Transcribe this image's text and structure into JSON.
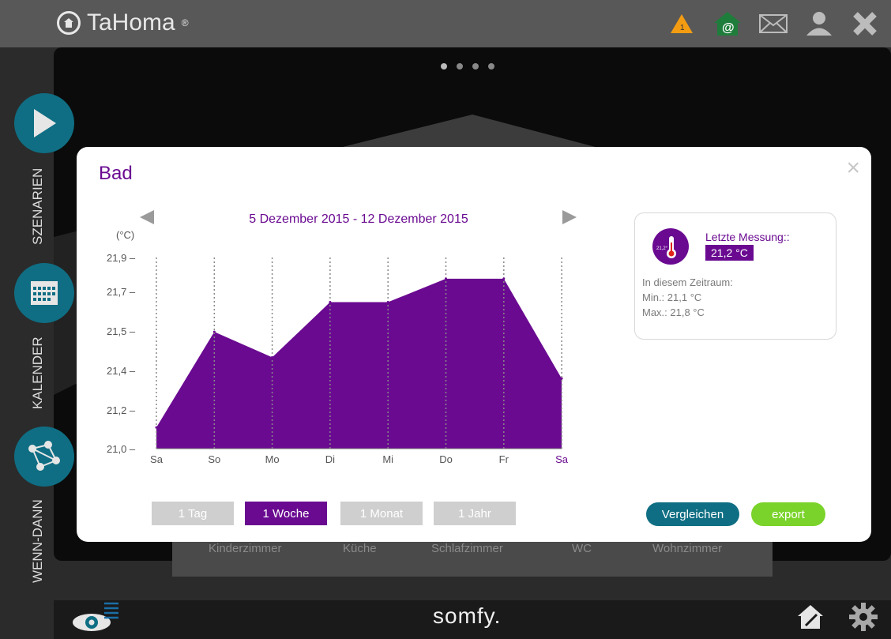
{
  "app": {
    "name": "TaHoma",
    "reg": "®",
    "footer_brand": "somfy."
  },
  "colors": {
    "accent": "#6a0a91",
    "teal": "#0f6e83",
    "green": "#7ad32a"
  },
  "top_icons": [
    "warning-icon",
    "home-web-icon",
    "mail-icon",
    "user-icon",
    "close-icon"
  ],
  "rail": {
    "scenarios": "SZENARIEN",
    "calendar": "KALENDER",
    "if_then": "WENN-DANN"
  },
  "rooms": [
    "Kinderzimmer",
    "Küche",
    "Schlafzimmer",
    "WC",
    "Wohnzimmer"
  ],
  "modal": {
    "title": "Bad",
    "close": "×",
    "date_range": "5 Dezember 2015 - 12 Dezember 2015",
    "range_buttons": [
      "1 Tag",
      "1 Woche",
      "1 Monat",
      "1 Jahr"
    ],
    "active_range": "1 Woche",
    "compare_label": "Vergleichen",
    "export_label": "export"
  },
  "info": {
    "last_label": "Letzte Messung::",
    "last_value": "21,2 °C",
    "therm_text": "21,2°",
    "period_label": "In diesem Zeitraum:",
    "min": "Min.: 21,1 °C",
    "max": "Max.: 21,8 °C"
  },
  "chart_data": {
    "type": "area",
    "unit_label": "(°C)",
    "categories": [
      "Sa",
      "So",
      "Mo",
      "Di",
      "Mi",
      "Do",
      "Fr",
      "Sa"
    ],
    "values": [
      21.1,
      21.55,
      21.43,
      21.69,
      21.69,
      21.8,
      21.8,
      21.33
    ],
    "y_ticks": [
      "21,0",
      "21,2",
      "21,4",
      "21,5",
      "21,7",
      "21,9"
    ],
    "ylim": [
      21.0,
      21.9
    ],
    "color": "#6a0a91",
    "grid": "vertical dotted"
  }
}
